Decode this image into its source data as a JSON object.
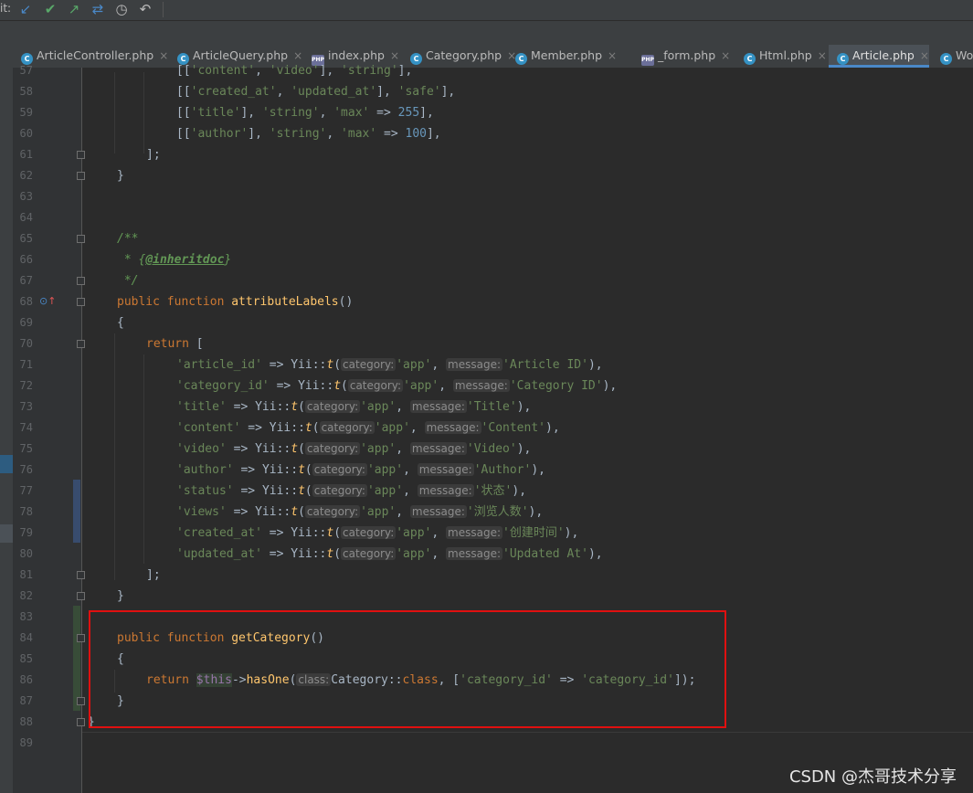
{
  "toolbar": {
    "label": "it:",
    "icons": [
      {
        "name": "update-project-icon",
        "glyph": "↙",
        "color": "#4a88c7"
      },
      {
        "name": "commit-icon",
        "glyph": "✔",
        "color": "#59a869"
      },
      {
        "name": "push-icon",
        "glyph": "↗",
        "color": "#59a869"
      },
      {
        "name": "merge-icon",
        "glyph": "⇄",
        "color": "#4a88c7"
      },
      {
        "name": "history-icon",
        "glyph": "◷",
        "color": "#bbbbbb"
      },
      {
        "name": "revert-icon",
        "glyph": "↶",
        "color": "#bbbbbb"
      }
    ]
  },
  "tabs": [
    {
      "label": "ArticleController.php",
      "type": "class"
    },
    {
      "label": "ArticleQuery.php",
      "type": "class"
    },
    {
      "label": "index.php",
      "type": "php"
    },
    {
      "label": "Category.php",
      "type": "class"
    },
    {
      "label": "Member.php",
      "type": "class"
    },
    {
      "label": "_form.php",
      "type": "php"
    },
    {
      "label": "Html.php",
      "type": "class"
    },
    {
      "label": "Article.php",
      "type": "class",
      "active": true
    },
    {
      "label": "Wo",
      "type": "class"
    }
  ],
  "line_numbers": [
    "57",
    "58",
    "59",
    "60",
    "61",
    "62",
    "63",
    "64",
    "65",
    "66",
    "67",
    "68",
    "69",
    "70",
    "71",
    "72",
    "73",
    "74",
    "75",
    "76",
    "77",
    "78",
    "79",
    "80",
    "81",
    "82",
    "83",
    "84",
    "85",
    "86",
    "87",
    "88",
    "89"
  ],
  "code": {
    "l57_a": "[[",
    "l57_b": "'content'",
    "l57_c": ", ",
    "l57_d": "'video'",
    "l57_e": "], ",
    "l57_f": "'string'",
    "l57_g": "],",
    "l58_a": "[[",
    "l58_b": "'created_at'",
    "l58_c": ", ",
    "l58_d": "'updated_at'",
    "l58_e": "], ",
    "l58_f": "'safe'",
    "l58_g": "],",
    "l59_a": "[[",
    "l59_b": "'title'",
    "l59_c": "], ",
    "l59_d": "'string'",
    "l59_e": ", ",
    "l59_f": "'max'",
    "l59_g": " => ",
    "l59_h": "255",
    "l59_i": "],",
    "l60_a": "[[",
    "l60_b": "'author'",
    "l60_c": "], ",
    "l60_d": "'string'",
    "l60_e": ", ",
    "l60_f": "'max'",
    "l60_g": " => ",
    "l60_h": "100",
    "l60_i": "],",
    "l61": "];",
    "l62": "}",
    "l65": "/**",
    "l66_a": " * {",
    "l66_b": "@inheritdoc",
    "l66_c": "}",
    "l67": " */",
    "l68_kw": "public function ",
    "l68_fn": "attributeLabels",
    "l68_end": "()",
    "l69": "{",
    "l70_kw": "return",
    "l70_end": " [",
    "labels": [
      {
        "key": "'article_id'",
        "cat": "'app'",
        "msg": "'Article ID'"
      },
      {
        "key": "'category_id'",
        "cat": "'app'",
        "msg": "'Category ID'"
      },
      {
        "key": "'title'",
        "cat": "'app'",
        "msg": "'Title'"
      },
      {
        "key": "'content'",
        "cat": "'app'",
        "msg": "'Content'"
      },
      {
        "key": "'video'",
        "cat": "'app'",
        "msg": "'Video'"
      },
      {
        "key": "'author'",
        "cat": "'app'",
        "msg": "'Author'"
      },
      {
        "key": "'status'",
        "cat": "'app'",
        "msg": "'状态'"
      },
      {
        "key": "'views'",
        "cat": "'app'",
        "msg": "'浏览人数'"
      },
      {
        "key": "'created_at'",
        "cat": "'app'",
        "msg": "'创建时间'"
      },
      {
        "key": "'updated_at'",
        "cat": "'app'",
        "msg": "'Updated At'"
      }
    ],
    "arrow": " => ",
    "yii": "Yii::",
    "t": "t",
    "paren": "(",
    "hint_category": "category:",
    "hint_message": "message:",
    "hint_class": "class:",
    "comma": ", ",
    "close": "),",
    "l81": "];",
    "l82": "}",
    "l84_kw": "public function ",
    "l84_fn": "getCategory",
    "l84_end": "()",
    "l85": "{",
    "l86_kw": "return ",
    "l86_var": "$this",
    "l86_arrow": "->",
    "l86_fn": "hasOne",
    "l86_paren": "(",
    "l86_cls": "Category::",
    "l86_kw2": "class",
    "l86_sep": ", [",
    "l86_s1": "'category_id'",
    "l86_arr": " => ",
    "l86_s2": "'category_id'",
    "l86_end": "]);",
    "l87": "}",
    "l88": "}"
  },
  "watermark": "CSDN @杰哥技术分享",
  "colors": {
    "keyword": "#cc7832",
    "string": "#6a8759",
    "number": "#6897bb",
    "function": "#ffc66d",
    "highlight_box": "#e01010"
  }
}
